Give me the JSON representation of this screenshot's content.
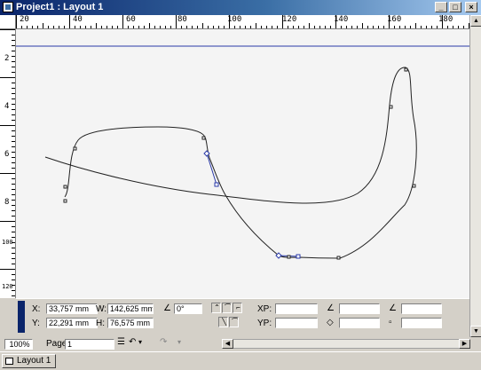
{
  "window": {
    "title": "Project1 : Layout 1"
  },
  "ruler_h": {
    "labels": [
      {
        "text": "20",
        "pos": 0.5
      },
      {
        "text": "40",
        "pos": 12.5
      },
      {
        "text": "60",
        "pos": 24.5
      },
      {
        "text": "80",
        "pos": 36.5
      },
      {
        "text": "100",
        "pos": 48.5
      },
      {
        "text": "120",
        "pos": 60.5
      },
      {
        "text": "140",
        "pos": 72.5
      },
      {
        "text": "160",
        "pos": 84.5
      },
      {
        "text": "180",
        "pos": 96.5
      }
    ]
  },
  "ruler_v": {
    "labels": [
      {
        "text": "2"
      },
      {
        "text": "4"
      },
      {
        "text": "6"
      },
      {
        "text": "8"
      },
      {
        "text": "100"
      },
      {
        "text": "120"
      }
    ]
  },
  "measurements": {
    "x_label": "X:",
    "x_value": "33,757 mm",
    "y_label": "Y:",
    "y_value": "22,291 mm",
    "w_label": "W:",
    "w_value": "142,625 mm",
    "h_label": "H:",
    "h_value": "76,575 mm",
    "angle_value": "0°",
    "xp_label": "XP:",
    "yp_label": "YP:"
  },
  "status": {
    "zoom": "100%",
    "page_label": "Page:",
    "page_value": "1"
  },
  "tabs": [
    {
      "label": "Layout 1"
    }
  ]
}
